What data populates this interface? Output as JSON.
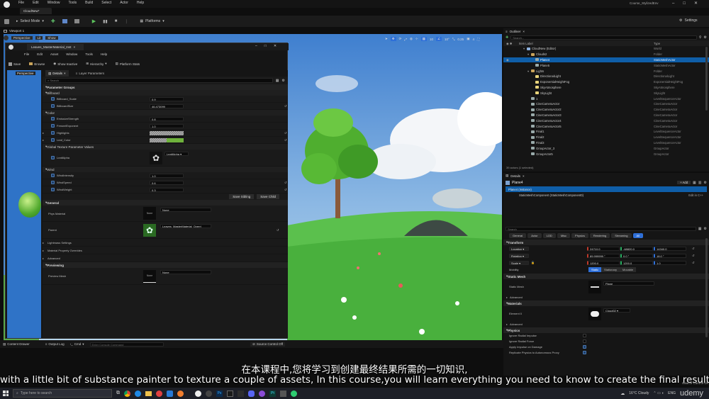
{
  "ue": {
    "menu": [
      "File",
      "Edit",
      "Window",
      "Tools",
      "Build",
      "Select",
      "Actor",
      "Help"
    ],
    "level_tab": "CloudNew*",
    "project_name": "Course_StylizedEnv",
    "select_mode": "Select Mode",
    "platforms": "Platforms",
    "settings": "Settings",
    "viewport_tab": "Viewport 1",
    "perspective": "Perspective",
    "lit": "Lit",
    "show": "Show",
    "grid_snap": "10",
    "rot_snap": "10°",
    "scale_snap": "0.25",
    "cam_speed": "4"
  },
  "mat_editor": {
    "tab": "Leaves_MasterMaterial_Inst",
    "menu": [
      "File",
      "Edit",
      "Asset",
      "Window",
      "Tools",
      "Help"
    ],
    "toolbar": [
      "Save",
      "Browse",
      "Show Inactive",
      "Hierarchy",
      "Platform Stats"
    ],
    "preview_label": "Perspective",
    "details_tab": "Details",
    "layer_tab": "Layer Parameters",
    "search_placeholder": "Search",
    "parameter_groups": "Parameter Groups",
    "groups": {
      "billboard": {
        "title": "Billboard",
        "params": [
          {
            "name": "Billboard_Scale",
            "value": "0.9"
          },
          {
            "name": "BillboardSize",
            "value": "46.473099"
          }
        ]
      },
      "color": {
        "title": "Color",
        "params": [
          {
            "name": "EmissiveStrength",
            "value": "0.8"
          },
          {
            "name": "FresnelExponent",
            "value": "1.0"
          },
          {
            "name": "Highlights",
            "value": ""
          },
          {
            "name": "Leaf_Color",
            "value": ""
          }
        ]
      },
      "texture": {
        "title": "Global Texture Parameter Values",
        "param": "LeafAlpha",
        "asset": "LeafAlpha"
      },
      "wind": {
        "title": "Wind",
        "params": [
          {
            "name": "WindIntensity",
            "value": "1.0"
          },
          {
            "name": "WindSpeed",
            "value": "0.6"
          },
          {
            "name": "WindWeight",
            "value": "0.3"
          }
        ]
      }
    },
    "save_sibling": "Save Sibling",
    "save_child": "Save Child",
    "general": "General",
    "phys_material": "Phys Material",
    "phys_value": "None",
    "parent": "Parent",
    "parent_value": "Leaves_MasterMaterial_Overri",
    "lightmass": "Lightmass Settings",
    "mat_overrides": "Material Property Overrides",
    "advanced": "Advanced",
    "previewing": "Previewing",
    "preview_mesh": "Preview Mesh",
    "preview_mesh_value": "None",
    "none_thumb": "None"
  },
  "outliner": {
    "title": "Outliner",
    "search_placeholder": "Search...",
    "col_label": "Item Label",
    "col_type": "Type",
    "rows": [
      {
        "label": "CloudNew (Editor)",
        "type": "World",
        "indent": 1,
        "kind": "world",
        "sel": false
      },
      {
        "label": "Clouds2",
        "type": "Folder",
        "indent": 2,
        "kind": "folder",
        "sel": false
      },
      {
        "label": "Plane4",
        "type": "StaticMeshActor",
        "indent": 3,
        "kind": "mesh",
        "sel": true
      },
      {
        "label": "Plane5",
        "type": "StaticMeshActor",
        "indent": 3,
        "kind": "mesh",
        "sel": false
      },
      {
        "label": "Lights",
        "type": "Folder",
        "indent": 2,
        "kind": "folder",
        "sel": false
      },
      {
        "label": "DirectionalLight",
        "type": "DirectionalLight",
        "indent": 3,
        "kind": "light",
        "sel": false
      },
      {
        "label": "ExponentialHeightFog",
        "type": "ExponentialHeightFog",
        "indent": 3,
        "kind": "light",
        "sel": false
      },
      {
        "label": "SkyAtmosphere",
        "type": "SkyAtmosphere",
        "indent": 3,
        "kind": "light",
        "sel": false
      },
      {
        "label": "SkyLight",
        "type": "SkyLight",
        "indent": 3,
        "kind": "light",
        "sel": false
      },
      {
        "label": "1",
        "type": "LevelSequenceActor",
        "indent": 2,
        "kind": "actor",
        "sel": false
      },
      {
        "label": "CineCameraActor",
        "type": "CineCameraActor",
        "indent": 2,
        "kind": "actor",
        "sel": false
      },
      {
        "label": "CineCameraActor2",
        "type": "CineCameraActor",
        "indent": 2,
        "kind": "actor",
        "sel": false
      },
      {
        "label": "CineCameraActor3",
        "type": "CineCameraActor",
        "indent": 2,
        "kind": "actor",
        "sel": false
      },
      {
        "label": "CineCameraActor4",
        "type": "CineCameraActor",
        "indent": 2,
        "kind": "actor",
        "sel": false
      },
      {
        "label": "CineCameraActor5",
        "type": "CineCameraActor",
        "indent": 2,
        "kind": "actor",
        "sel": false
      },
      {
        "label": "Final1",
        "type": "LevelSequenceActor",
        "indent": 2,
        "kind": "actor",
        "sel": false
      },
      {
        "label": "Final2",
        "type": "LevelSequenceActor",
        "indent": 2,
        "kind": "actor",
        "sel": false
      },
      {
        "label": "Final3",
        "type": "LevelSequenceActor",
        "indent": 2,
        "kind": "actor",
        "sel": false
      },
      {
        "label": "GroupActor_3",
        "type": "GroupActor",
        "indent": 2,
        "kind": "actor",
        "sel": false
      },
      {
        "label": "GroupActor5",
        "type": "GroupActor",
        "indent": 2,
        "kind": "actor",
        "sel": false
      }
    ],
    "footer": "39 actors (1 selected)"
  },
  "details": {
    "title": "Details",
    "actor": "Plane4",
    "add": "+ Add",
    "instance": "Plane4 (Instance)",
    "component": "StaticMeshComponent (StaticMeshComponent0)",
    "component_note": "Edit in C++",
    "search_placeholder": "Search",
    "tabs": [
      "General",
      "Actor",
      "LOD",
      "Misc",
      "Physics",
      "Rendering",
      "Streaming",
      "All"
    ],
    "transform": "Transform",
    "location": {
      "label": "Location",
      "x": "24710.0",
      "y": "-68820.0",
      "z": "14340.0"
    },
    "rotation": {
      "label": "Rotation",
      "x": "89.999999 °",
      "y": "0.0 °",
      "z": "18.0 °"
    },
    "scale": {
      "label": "Scale",
      "x": "1200.0",
      "y": "1200.0",
      "z": "1.0"
    },
    "mobility": {
      "label": "Mobility",
      "options": [
        "Static",
        "Stationary",
        "Movable"
      ]
    },
    "static_mesh_section": "Static Mesh",
    "static_mesh_label": "Static Mesh",
    "static_mesh_value": "Plane",
    "advanced": "Advanced",
    "materials": "Materials",
    "element0": "Element 0",
    "element0_value": "Cloud02",
    "physics": "Physics",
    "physics_rows": [
      "Ignore Radial Impulse",
      "Ignore Radial Force",
      "Apply Impulse on Damage",
      "Replicate Physics to Autonomous Proxy"
    ]
  },
  "bottom_bar": {
    "content_drawer": "Content Drawer",
    "output_log": "Output Log",
    "cmd": "Cmd",
    "console_placeholder": "Enter Console Command",
    "source_control": "Source Control Off",
    "source_control2": "Source Control Off"
  },
  "subtitles": {
    "cn": "在本课程中,您将学习到创建最终结果所需的一切知识,",
    "en": "with a little bit of substance painter to texture a couple of assets, In this course,you will learn everything you need to know to create the final results,"
  },
  "taskbar": {
    "search_placeholder": "Type here to search",
    "weather": "16°C Cloudy",
    "lang": "ENG",
    "watermark": "udemy"
  },
  "colors": {
    "accent": "#2e6fd8",
    "selection": "#0f5ea8",
    "leaf_green": "#6fb23c",
    "panel": "#151515"
  }
}
